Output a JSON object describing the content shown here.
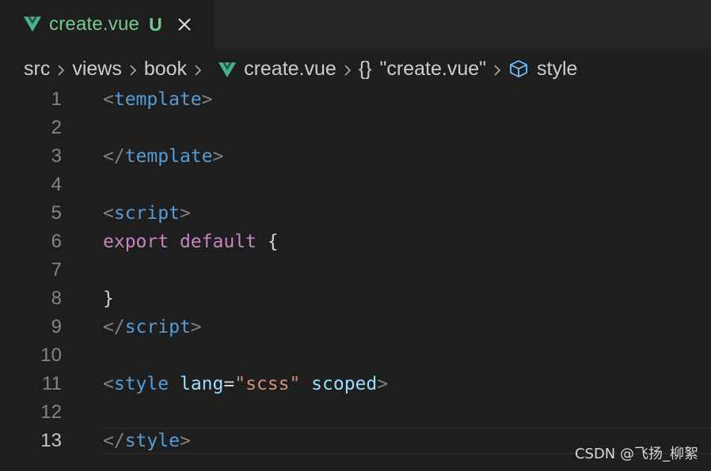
{
  "tab": {
    "title": "create.vue",
    "status": "U",
    "icon": "vue-icon",
    "close_icon": "close-icon",
    "colors": {
      "title": "#73c991",
      "vue": "#41b883"
    }
  },
  "breadcrumb": {
    "segments": [
      "src",
      "views",
      "book",
      "create.vue",
      "\"create.vue\"",
      "style"
    ],
    "braces": "{}",
    "icons": {
      "file": "vue-icon",
      "object": "braces-icon",
      "struct": "cube-icon"
    }
  },
  "editor": {
    "active_line": 13,
    "line_numbers": [
      "1",
      "2",
      "3",
      "4",
      "5",
      "6",
      "7",
      "8",
      "9",
      "10",
      "11",
      "12",
      "13"
    ],
    "lines": [
      {
        "lt": "<",
        "name": "template",
        "gt": ">"
      },
      {},
      {
        "lt": "</",
        "name": "template",
        "gt": ">"
      },
      {},
      {
        "lt": "<",
        "name": "script",
        "gt": ">"
      },
      {
        "kw1": "export",
        "kw2": "default",
        "brace": "{"
      },
      {},
      {
        "brace": "}"
      },
      {
        "lt": "</",
        "name": "script",
        "gt": ">"
      },
      {},
      {
        "lt": "<",
        "name": "style",
        "attr1": "lang",
        "eq": "=",
        "val": "\"scss\"",
        "attr2": "scoped",
        "gt": ">"
      },
      {},
      {
        "lt": "</",
        "name": "style",
        "gt": ">"
      }
    ]
  },
  "watermark": "CSDN @飞扬_柳絮"
}
